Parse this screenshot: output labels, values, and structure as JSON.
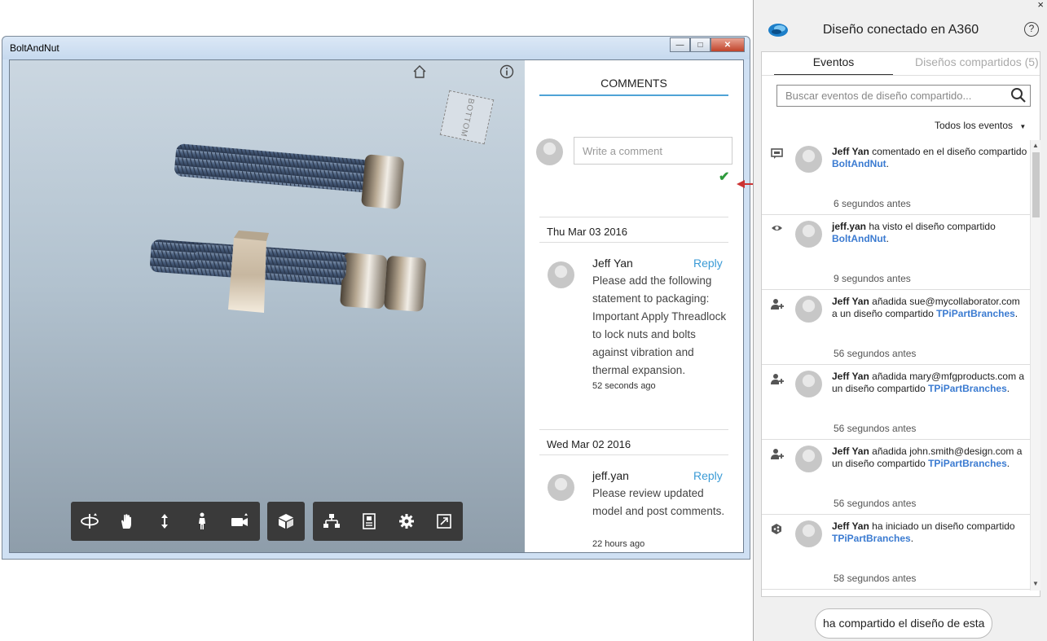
{
  "viewer": {
    "title": "BoltAndNut",
    "viewcube_label": "BOTTOM",
    "toolbar": {
      "group1": [
        "orbit-icon",
        "pan-icon",
        "zoom-icon",
        "walk-icon",
        "camera-icon"
      ],
      "group2": [
        "view-cube-icon"
      ],
      "group3": [
        "structure-icon",
        "properties-icon",
        "settings-icon",
        "fullscreen-icon"
      ]
    },
    "comments": {
      "heading": "COMMENTS",
      "input_placeholder": "Write a comment",
      "threads": [
        {
          "date": "Thu Mar 03 2016",
          "author": "Jeff Yan",
          "reply_label": "Reply",
          "text": "Please add the following statement to packaging: Important Apply Threadlock to lock nuts and bolts against vibration and thermal expansion.",
          "time": "52 seconds ago"
        },
        {
          "date": "Wed Mar 02 2016",
          "author": "jeff.yan",
          "reply_label": "Reply",
          "text": "Please review updated model and post comments.",
          "time": "22 hours ago"
        }
      ]
    }
  },
  "a360": {
    "title": "Diseño conectado en A360",
    "help": "?",
    "close": "×",
    "tabs": {
      "active": "Eventos",
      "inactive": "Diseños compartidos (5)"
    },
    "search_placeholder": "Buscar eventos de diseño compartido...",
    "filter_label": "Todos los eventos",
    "events": [
      {
        "icon": "comment-icon",
        "user": "Jeff Yan",
        "pre": " comentado en el diseño compartido ",
        "link": "BoltAndNut",
        "post": ".",
        "time": "6 segundos antes"
      },
      {
        "icon": "eye-icon",
        "user": "jeff.yan",
        "pre": " ha visto el diseño compartido ",
        "link": "BoltAndNut",
        "post": ".",
        "time": "9 segundos antes"
      },
      {
        "icon": "add-user-icon",
        "user": "Jeff Yan",
        "pre": " añadida sue@mycollaborator.com a un diseño compartido ",
        "link": "TPiPartBranches",
        "post": ".",
        "time": "56 segundos antes"
      },
      {
        "icon": "add-user-icon",
        "user": "Jeff Yan",
        "pre": " añadida mary@mfgproducts.com a un diseño compartido ",
        "link": "TPiPartBranches",
        "post": ".",
        "time": "56 segundos antes"
      },
      {
        "icon": "add-user-icon",
        "user": "Jeff Yan",
        "pre": " añadida john.smith@design.com a un diseño compartido ",
        "link": "TPiPartBranches",
        "post": ".",
        "time": "56 segundos antes"
      },
      {
        "icon": "share-icon",
        "user": "Jeff Yan",
        "pre": " ha iniciado un diseño compartido ",
        "link": "TPiPartBranches",
        "post": ".",
        "time": "58 segundos antes"
      }
    ],
    "bubble": "ha compartido el diseño de esta",
    "colors": {
      "accent": "#4fa3d6",
      "link": "#3b7bd1",
      "arrow": "#cc3333"
    }
  }
}
